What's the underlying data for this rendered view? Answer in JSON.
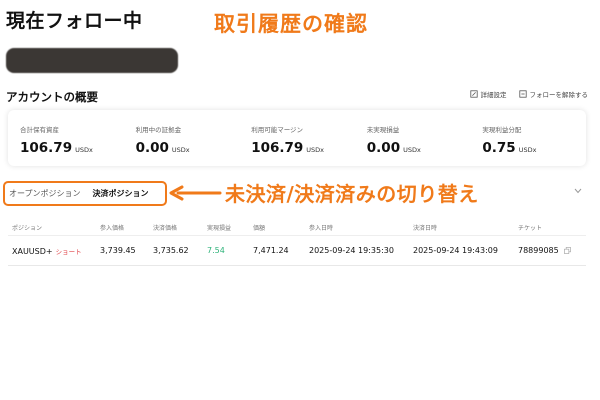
{
  "header": {
    "title": "現在フォロー中",
    "annotation": "取引履歴の確認"
  },
  "account": {
    "section_title": "アカウントの概要",
    "actions": [
      {
        "label": "詳細設定",
        "icon": "edit-icon"
      },
      {
        "label": "フォローを解除する",
        "icon": "unfollow-icon"
      }
    ],
    "stats": [
      {
        "label": "合計保有資産",
        "value": "106.79",
        "unit": "USDx"
      },
      {
        "label": "利用中の証拠金",
        "value": "0.00",
        "unit": "USDx"
      },
      {
        "label": "利用可能マージン",
        "value": "106.79",
        "unit": "USDx"
      },
      {
        "label": "未実現損益",
        "value": "0.00",
        "unit": "USDx"
      },
      {
        "label": "実現利益分配",
        "value": "0.75",
        "unit": "USDx"
      }
    ]
  },
  "tabs": {
    "open": "オープンポジション",
    "closed": "決済ポジション",
    "annotation": "未決済/決済済みの切り替え"
  },
  "table": {
    "headers": [
      "ポジション",
      "参入価格",
      "決済価格",
      "実現損益",
      "価額",
      "参入日時",
      "決済日時",
      "チケット"
    ],
    "rows": [
      {
        "symbol": "XAUUSD+",
        "side": "ショート",
        "entry_price": "3,739.45",
        "exit_price": "3,735.62",
        "realized_pnl": "7.54",
        "value": "7,471.24",
        "entry_time": "2025-09-24 19:35:30",
        "exit_time": "2025-09-24 19:43:09",
        "ticket": "78899085"
      }
    ]
  },
  "colors": {
    "annotation": "#f07a1a",
    "short": "#e0454a",
    "profit": "#2fb37a",
    "redaction": "#3b3734"
  }
}
